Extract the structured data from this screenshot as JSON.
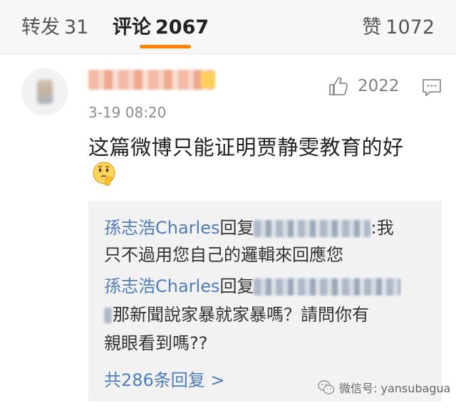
{
  "tabs": {
    "repost": {
      "label": "转发",
      "count": "31"
    },
    "comment": {
      "label": "评论",
      "count": "2067"
    },
    "like": {
      "label": "赞",
      "count": "1072"
    }
  },
  "colors": {
    "accent": "#ff8200",
    "link": "#4f7db8",
    "reply_bg": "#f2f2f2"
  },
  "comment": {
    "time": "3-19 08:20",
    "like_count": "2022",
    "text": "这篇微博只能证明贾静雯教育的好",
    "emoji": "thinking-face-emoji",
    "replies": {
      "r1_author": "孫志浩Charles",
      "r1_verb": "回复",
      "r1_after": ":我",
      "r1_cont": "只不過用您自己的邏輯來回應您",
      "r2_author": "孫志浩Charles",
      "r2_verb": "回复",
      "r2_cont1": "那新聞說家暴就家暴嗎？請問你有",
      "r2_cont2": "親眼看到嗎??",
      "more": "共286条回复 >"
    }
  },
  "icons": [
    "thumbs-up-icon",
    "reply-icon",
    "wechat-icon"
  ],
  "watermark": "微信号: yansubagua"
}
